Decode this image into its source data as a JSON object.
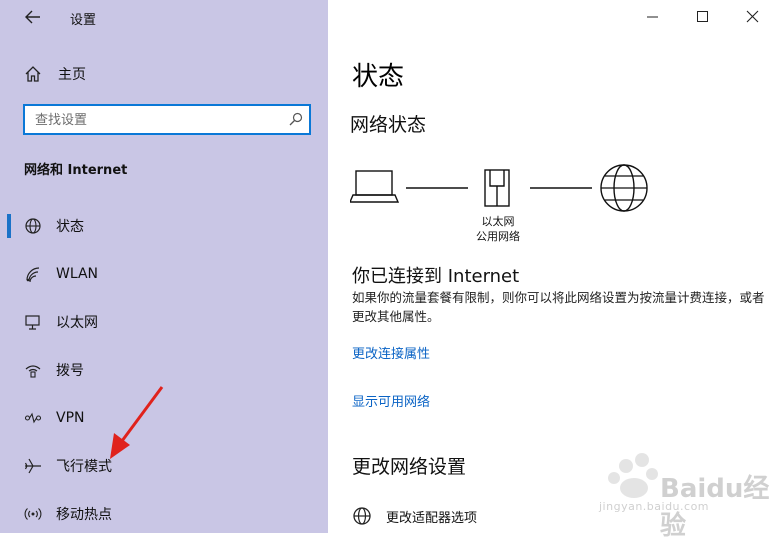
{
  "window": {
    "title": "设置"
  },
  "sidebar": {
    "home_label": "主页",
    "search": {
      "placeholder": "查找设置"
    },
    "section_title": "网络和 Internet",
    "items": [
      {
        "label": "状态",
        "icon": "globe-icon",
        "active": true
      },
      {
        "label": "WLAN",
        "icon": "wifi-icon"
      },
      {
        "label": "以太网",
        "icon": "ethernet-icon"
      },
      {
        "label": "拨号",
        "icon": "dialup-icon"
      },
      {
        "label": "VPN",
        "icon": "vpn-icon"
      },
      {
        "label": "飞行模式",
        "icon": "airplane-icon"
      },
      {
        "label": "移动热点",
        "icon": "hotspot-icon"
      }
    ]
  },
  "main": {
    "page_title": "状态",
    "network_status_title": "网络状态",
    "diagram": {
      "adapter_name": "以太网",
      "network_type": "公用网络"
    },
    "connected_heading": "你已连接到 Internet",
    "connected_desc": "如果你的流量套餐有限制，则你可以将此网络设置为按流量计费连接，或者更改其他属性。",
    "links": {
      "change_properties": "更改连接属性",
      "show_networks": "显示可用网络"
    },
    "change_settings_title": "更改网络设置",
    "adapter_options": "更改适配器选项"
  },
  "watermark": {
    "text": "Baidu经验",
    "url": "jingyan.baidu.com"
  },
  "colors": {
    "sidebar_bg": "#c9c6e5",
    "accent": "#0a78d7",
    "link": "#0a63c5",
    "arrow": "#e0221c"
  }
}
